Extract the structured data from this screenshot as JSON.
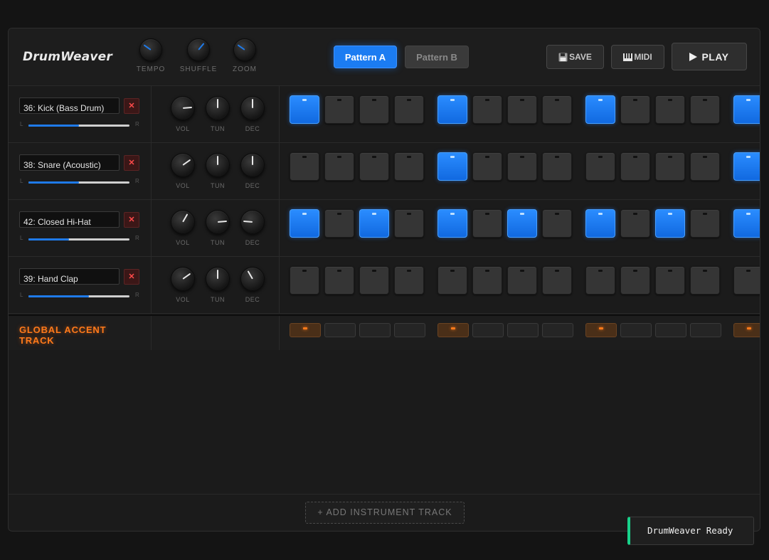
{
  "app": {
    "title": "DrumWeaver"
  },
  "header": {
    "knobs": [
      {
        "label": "TEMPO",
        "angle": -55,
        "color": "#1f7ae8"
      },
      {
        "label": "SHUFFLE",
        "angle": 40,
        "color": "#1f7ae8"
      },
      {
        "label": "ZOOM",
        "angle": -55,
        "color": "#1f7ae8"
      }
    ],
    "pattern_a": "Pattern A",
    "pattern_b": "Pattern B",
    "active_pattern": "Pattern A",
    "save_label": "SAVE",
    "midi_label": "MIDI",
    "play_label": "PLAY",
    "save_icon": "floppy-disk-icon",
    "midi_icon": "piano-keys-icon",
    "play_icon": "play-icon"
  },
  "knob_labels": {
    "vol": "VOL",
    "tun": "TUN",
    "dec": "DEC"
  },
  "pan_labels": {
    "left": "L",
    "right": "R"
  },
  "tracks": [
    {
      "name": "36: Kick (Bass Drum)",
      "pan": 0.5,
      "vol": 85,
      "tun": 0,
      "dec": 0,
      "steps": [
        1,
        0,
        0,
        0,
        1,
        0,
        0,
        0,
        1,
        0,
        0,
        0,
        1
      ]
    },
    {
      "name": "38: Snare (Acoustic)",
      "pan": 0.5,
      "vol": 55,
      "tun": 0,
      "dec": 0,
      "steps": [
        0,
        0,
        0,
        0,
        1,
        0,
        0,
        0,
        0,
        0,
        0,
        0,
        1
      ]
    },
    {
      "name": "42: Closed Hi-Hat",
      "pan": 0.4,
      "vol": 30,
      "tun": 85,
      "dec": -85,
      "steps": [
        1,
        0,
        1,
        0,
        1,
        0,
        1,
        0,
        1,
        0,
        1,
        0,
        1
      ]
    },
    {
      "name": "39: Hand Clap",
      "pan": 0.6,
      "vol": 55,
      "tun": 0,
      "dec": -30,
      "steps": [
        0,
        0,
        0,
        0,
        0,
        0,
        0,
        0,
        0,
        0,
        0,
        0,
        0
      ]
    }
  ],
  "accent": {
    "label": "GLOBAL ACCENT TRACK",
    "steps": [
      1,
      0,
      0,
      0,
      1,
      0,
      0,
      0,
      1,
      0,
      0,
      0,
      1
    ]
  },
  "footer": {
    "add_track_label": "+ ADD INSTRUMENT TRACK"
  },
  "toast": {
    "message": "DrumWeaver Ready"
  },
  "colors": {
    "accent_blue": "#1f7ae8",
    "accent_orange": "#ff7a1a",
    "ready_green": "#18d28a"
  }
}
